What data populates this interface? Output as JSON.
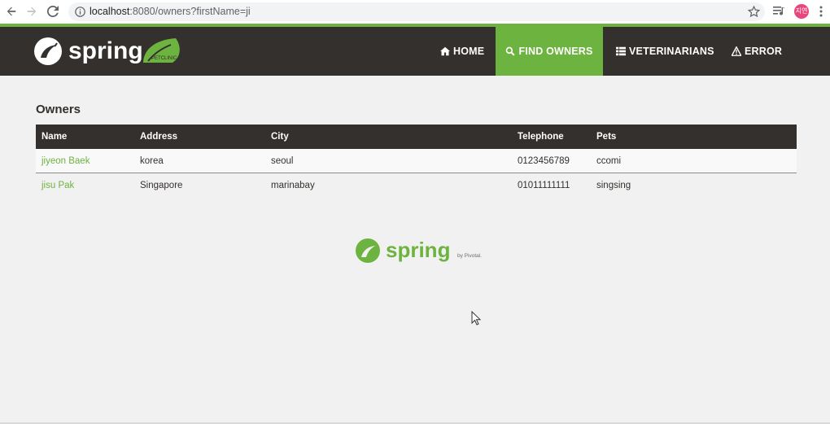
{
  "browser": {
    "url_host": "localhost",
    "url_rest": ":8080/owners?firstName=ji",
    "profile_initials": "지연"
  },
  "navbar": {
    "brand": "spring",
    "brand_badge": "PETCLINIC",
    "items": [
      {
        "label": "HOME",
        "icon": "home-icon",
        "active": false
      },
      {
        "label": "FIND OWNERS",
        "icon": "search-icon",
        "active": true
      },
      {
        "label": "VETERINARIANS",
        "icon": "list-icon",
        "active": false
      },
      {
        "label": "ERROR",
        "icon": "warning-icon",
        "active": false
      }
    ]
  },
  "colors": {
    "brand_green": "#6db33f",
    "navbar_dark": "#34302d",
    "page_bg": "#f1f1f1"
  },
  "main": {
    "title": "Owners",
    "table": {
      "headers": [
        "Name",
        "Address",
        "City",
        "Telephone",
        "Pets"
      ],
      "rows": [
        {
          "name": "jiyeon Baek",
          "address": "korea",
          "city": "seoul",
          "telephone": "0123456789",
          "pets": "ccomi"
        },
        {
          "name": "jisu Pak",
          "address": "Singapore",
          "city": "marinabay",
          "telephone": "01011111111",
          "pets": "singsing"
        }
      ]
    }
  },
  "footer": {
    "brand": "spring",
    "byline": "by Pivotal."
  }
}
